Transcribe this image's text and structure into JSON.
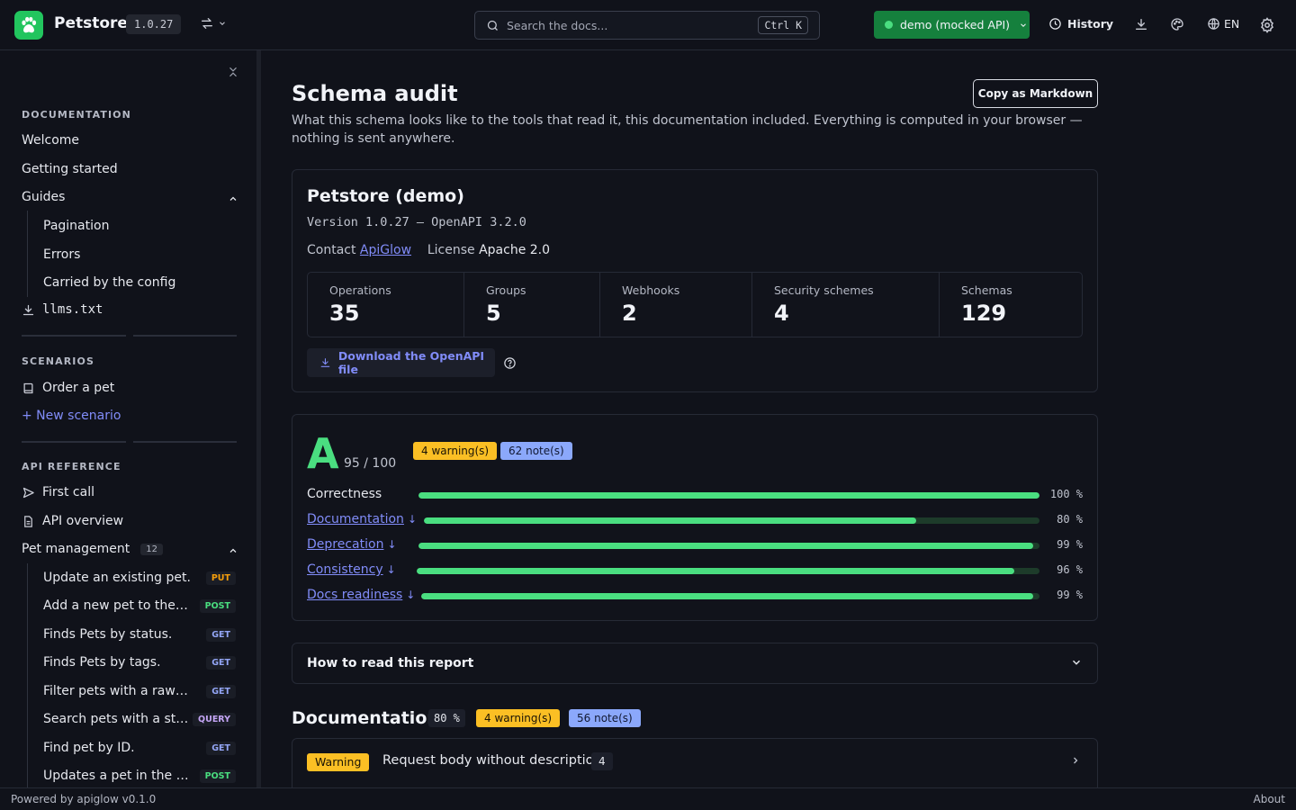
{
  "header": {
    "app_name": "Petstore",
    "version": "1.0.27",
    "search_placeholder": "Search the docs...",
    "search_shortcut": "Ctrl K",
    "environment": "demo (mocked API)",
    "history_label": "History",
    "language": "EN",
    "colors": {
      "brand": "#22c55e",
      "environment_bg": "#15803d"
    }
  },
  "sidebar": {
    "documentation_title": "DOCUMENTATION",
    "documentation_items": [
      "Welcome",
      "Getting started"
    ],
    "guides_label": "Guides",
    "guides_items": [
      "Pagination",
      "Errors",
      "Carried by the config"
    ],
    "llms_label": "llms.txt",
    "scenarios_title": "SCENARIOS",
    "scenario_item": "Order a pet",
    "new_scenario": "+ New scenario",
    "api_reference_title": "API REFERENCE",
    "first_call": "First call",
    "api_overview": "API overview",
    "pet_management_label": "Pet management",
    "pet_management_count": "12",
    "endpoints": [
      {
        "label": "Update an existing pet.",
        "method": "PUT"
      },
      {
        "label": "Add a new pet to the st...",
        "method": "POST"
      },
      {
        "label": "Finds Pets by status.",
        "method": "GET"
      },
      {
        "label": "Finds Pets by tags.",
        "method": "GET"
      },
      {
        "label": "Filter pets with a raw qu...",
        "method": "GET"
      },
      {
        "label": "Search pets with a stru...",
        "method": "QUERY"
      },
      {
        "label": "Find pet by ID.",
        "method": "GET"
      },
      {
        "label": "Updates a pet in the st...",
        "method": "POST"
      }
    ]
  },
  "main": {
    "title": "Schema audit",
    "copy_button": "Copy as Markdown",
    "description": "What this schema looks like to the tools that read it, this documentation included. Everything is computed in your browser — nothing is sent anywhere.",
    "api": {
      "title": "Petstore (demo)",
      "version_line": "Version 1.0.27 — OpenAPI 3.2.0",
      "contact_label": "Contact",
      "contact_value": "ApiGlow",
      "license_label": "License",
      "license_value": "Apache 2.0",
      "stats": [
        {
          "label": "Operations",
          "value": "35"
        },
        {
          "label": "Groups",
          "value": "5"
        },
        {
          "label": "Webhooks",
          "value": "2"
        },
        {
          "label": "Security schemes",
          "value": "4"
        },
        {
          "label": "Schemas",
          "value": "129"
        }
      ],
      "download_label": "Download the OpenAPI file"
    },
    "score": {
      "grade": "A",
      "score_text": "95 / 100",
      "warnings": "4 warning(s)",
      "notes": "62 note(s)",
      "bars": [
        {
          "label": "Correctness",
          "value": 100,
          "pct_label": "100 %",
          "link": false
        },
        {
          "label": "Documentation",
          "value": 80,
          "pct_label": "80 %",
          "link": true
        },
        {
          "label": "Deprecation",
          "value": 99,
          "pct_label": "99 %",
          "link": true
        },
        {
          "label": "Consistency",
          "value": 96,
          "pct_label": "96 %",
          "link": true
        },
        {
          "label": "Docs readiness",
          "value": 99,
          "pct_label": "99 %",
          "link": true
        }
      ]
    },
    "how_to_read": "How to read this report",
    "documentation_section": {
      "title": "Documentation",
      "pct": "80 %",
      "warnings": "4 warning(s)",
      "notes": "56 note(s)"
    },
    "finding": {
      "severity": "Warning",
      "text": "Request body without description",
      "count": "4"
    }
  },
  "footer": {
    "powered_by": "Powered by apiglow v0.1.0",
    "about": "About"
  }
}
